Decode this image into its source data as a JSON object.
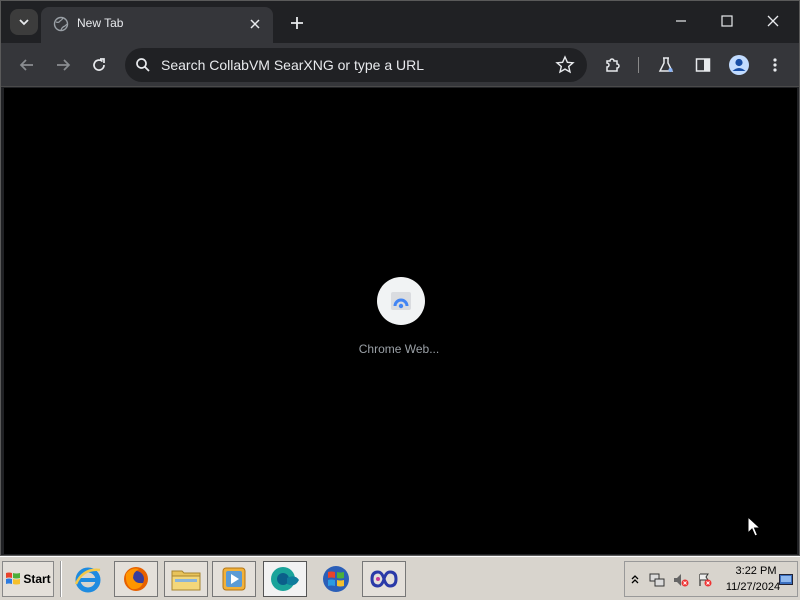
{
  "browser": {
    "tab": {
      "title": "New Tab"
    },
    "omnibox": {
      "placeholder": "Search CollabVM SearXNG or type a URL"
    }
  },
  "content": {
    "loading_label": "Chrome Web..."
  },
  "taskbar": {
    "start_label": "Start",
    "apps": [
      {
        "icon": "internet-explorer-icon"
      },
      {
        "icon": "firefox-icon"
      },
      {
        "icon": "file-explorer-icon"
      },
      {
        "icon": "media-player-icon"
      },
      {
        "icon": "chrome-loading-icon"
      },
      {
        "icon": "windows-logo-icon"
      },
      {
        "icon": "infinity-app-icon"
      }
    ],
    "clock": {
      "time": "3:22 PM",
      "date": "11/27/2024"
    }
  },
  "colors": {
    "tabstrip_bg": "#202124",
    "toolbar_bg": "#35363a",
    "content_bg": "#000000",
    "taskbar_bg": "#d8d4cd",
    "text_light": "#e8eaed"
  }
}
